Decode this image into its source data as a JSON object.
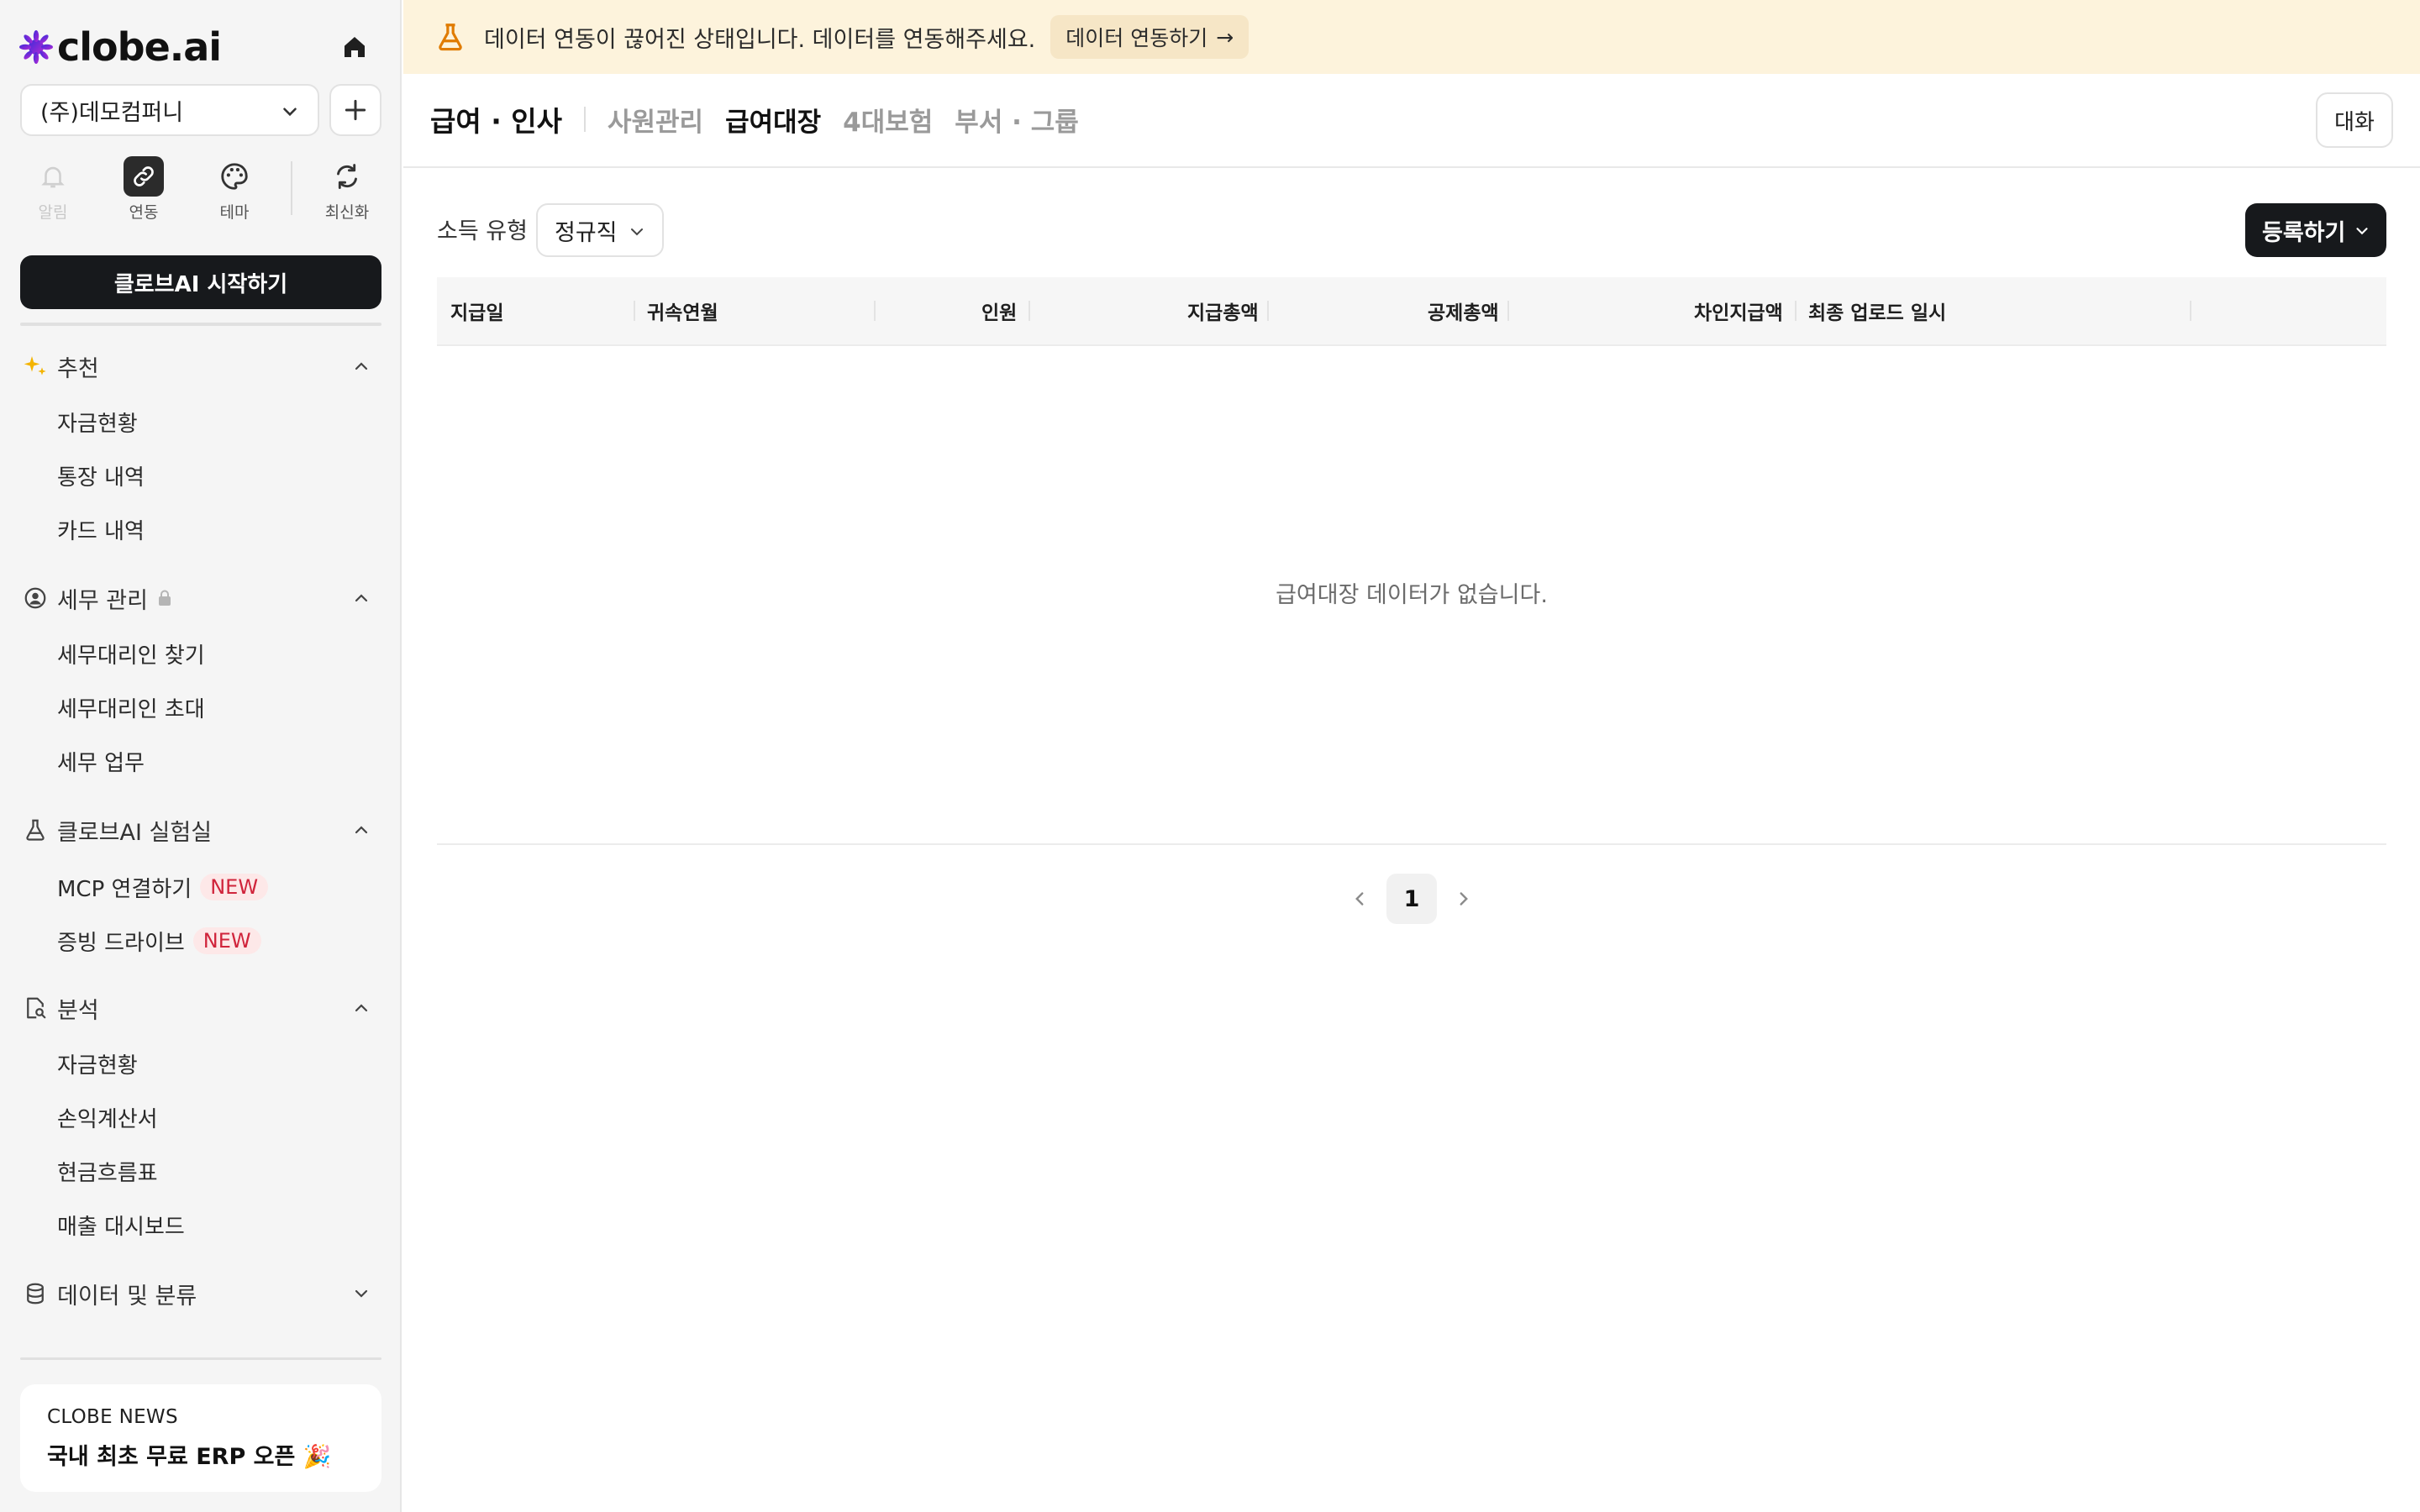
{
  "brand": {
    "name": "clobe.ai"
  },
  "company": {
    "selected": "(주)데모컴퍼니"
  },
  "quick_actions": [
    {
      "label": "알림",
      "icon": "bell-icon",
      "state": "disabled"
    },
    {
      "label": "연동",
      "icon": "link-icon",
      "state": "active"
    },
    {
      "label": "테마",
      "icon": "palette-icon",
      "state": "normal"
    },
    {
      "label": "최신화",
      "icon": "refresh-icon",
      "state": "normal"
    }
  ],
  "start_button": "클로브AI 시작하기",
  "sidebar": {
    "recommend": {
      "title": "추천",
      "items": [
        "자금현황",
        "통장 내역",
        "카드 내역"
      ]
    },
    "tax": {
      "title": "세무 관리",
      "items": [
        "세무대리인 찾기",
        "세무대리인 초대",
        "세무 업무"
      ]
    },
    "lab": {
      "title": "클로브AI 실험실",
      "items": [
        "MCP 연결하기",
        "증빙 드라이브"
      ],
      "badge": "NEW"
    },
    "analysis": {
      "title": "분석",
      "items": [
        "자금현황",
        "손익계산서",
        "현금흐름표",
        "매출 대시보드"
      ]
    },
    "data": {
      "title": "데이터 및 분류"
    }
  },
  "news": {
    "kicker": "CLOBE NEWS",
    "title": "국내 최초 무료 ERP 오픈 🎉"
  },
  "banner": {
    "message": "데이터 연동이 끊어진 상태입니다. 데이터를 연동해주세요.",
    "button": "데이터 연동하기",
    "arrow": "→"
  },
  "header": {
    "section": "급여 · 인사",
    "tabs": [
      "사원관리",
      "급여대장",
      "4대보험",
      "부서 · 그룹"
    ],
    "active_tab": "급여대장",
    "chat_button": "대화"
  },
  "filter": {
    "label": "소득 유형",
    "value": "정규직"
  },
  "register_button": "등록하기",
  "table": {
    "columns": [
      "지급일",
      "귀속연월",
      "인원",
      "지급총액",
      "공제총액",
      "차인지급액",
      "최종 업로드 일시"
    ],
    "empty_message": "급여대장 데이터가 없습니다."
  },
  "pagination": {
    "current": "1"
  },
  "colors": {
    "primary": "#17191c",
    "banner_bg": "#fdf3dc",
    "new_badge": "#d0243b",
    "sidebar_bg": "#f5f5f5"
  }
}
